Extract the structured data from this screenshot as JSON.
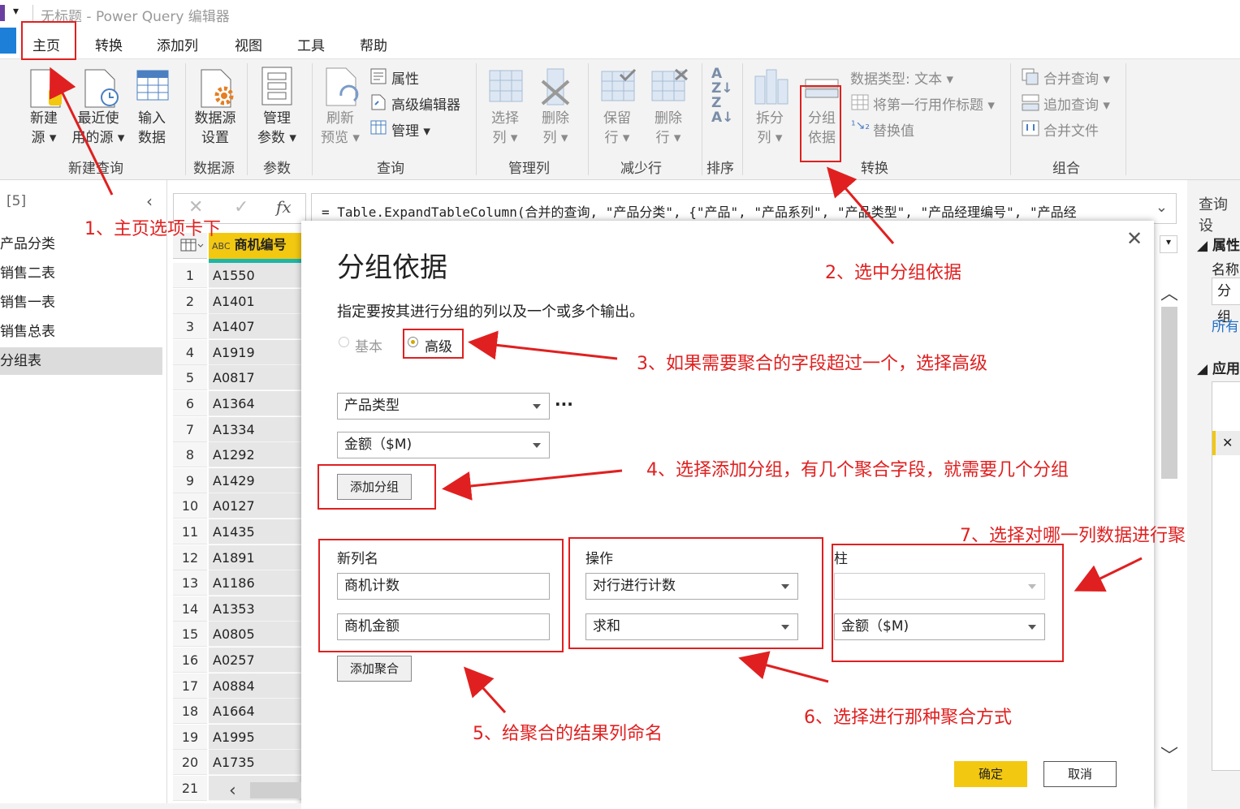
{
  "window": {
    "title": "无标题 - Power Query 编辑器"
  },
  "menu": {
    "items": [
      "主页",
      "转换",
      "添加列",
      "视图",
      "工具",
      "帮助"
    ]
  },
  "ribbon": {
    "new_query": {
      "new_source": "新建\n源 ▾",
      "recent_sources": "最近使\n用的源 ▾",
      "enter_data": "输入\n数据",
      "group": "新建查询"
    },
    "datasource": {
      "settings": "数据源\n设置",
      "group": "数据源"
    },
    "params": {
      "manage": "管理\n参数 ▾",
      "group": "参数"
    },
    "query": {
      "refresh": "刷新\n预览 ▾",
      "properties": "属性",
      "advanced_editor": "高级编辑器",
      "manage": "管理 ▾",
      "group": "查询"
    },
    "manage_cols": {
      "choose": "选择\n列 ▾",
      "remove": "删除\n列 ▾",
      "group": "管理列"
    },
    "reduce_rows": {
      "keep": "保留\n行 ▾",
      "remove": "删除\n行 ▾",
      "group": "减少行"
    },
    "sort": {
      "group": "排序"
    },
    "transform": {
      "split": "拆分\n列 ▾",
      "group_by": "分组\n依据",
      "data_type": "数据类型: 文本 ▾",
      "first_row_header": "将第一行用作标题 ▾",
      "replace": "替换值",
      "group": "转换"
    },
    "combine": {
      "merge": "合并查询 ▾",
      "append": "追加查询 ▾",
      "combine_files": "合并文件",
      "group": "组合"
    }
  },
  "left_panel": {
    "header": "[5]",
    "queries": [
      "产品分类",
      "销售二表",
      "销售一表",
      "销售总表",
      "分组表"
    ]
  },
  "formula": {
    "fx": "fx",
    "text": "= Table.ExpandTableColumn(合并的查询, \"产品分类\", {\"产品\", \"产品系列\", \"产品类型\", \"产品经理编号\", \"产品经"
  },
  "grid": {
    "col_type": "ABC",
    "col_header": "商机编号",
    "rows": [
      {
        "n": "1",
        "v": "A1550"
      },
      {
        "n": "2",
        "v": "A1401"
      },
      {
        "n": "3",
        "v": "A1407"
      },
      {
        "n": "4",
        "v": "A1919"
      },
      {
        "n": "5",
        "v": "A0817"
      },
      {
        "n": "6",
        "v": "A1364"
      },
      {
        "n": "7",
        "v": "A1334"
      },
      {
        "n": "8",
        "v": "A1292"
      },
      {
        "n": "9",
        "v": "A1429"
      },
      {
        "n": "10",
        "v": "A0127"
      },
      {
        "n": "11",
        "v": "A1435"
      },
      {
        "n": "12",
        "v": "A1891"
      },
      {
        "n": "13",
        "v": "A1186"
      },
      {
        "n": "14",
        "v": "A1353"
      },
      {
        "n": "15",
        "v": "A0805"
      },
      {
        "n": "16",
        "v": "A0257"
      },
      {
        "n": "17",
        "v": "A0884"
      },
      {
        "n": "18",
        "v": "A1664"
      },
      {
        "n": "19",
        "v": "A1995"
      },
      {
        "n": "20",
        "v": "A1735"
      },
      {
        "n": "21",
        "v": ""
      }
    ]
  },
  "right_panel": {
    "title": "查询设",
    "properties": "属性",
    "name_label": "名称",
    "name_value": "分组",
    "all_props": "所有",
    "applied": "应用"
  },
  "dialog": {
    "title": "分组依据",
    "description": "指定要按其进行分组的列以及一个或多个输出。",
    "radio_basic": "基本",
    "radio_advanced": "高级",
    "group_cols": [
      "产品类型",
      "金额（$M)"
    ],
    "more": "···",
    "add_group": "添加分组",
    "headers": {
      "name": "新列名",
      "operation": "操作",
      "column": "柱"
    },
    "aggs": [
      {
        "name": "商机计数",
        "op": "对行进行计数",
        "col": ""
      },
      {
        "name": "商机金额",
        "op": "求和",
        "col": "金额（$M)"
      }
    ],
    "add_agg": "添加聚合",
    "ok": "确定",
    "cancel": "取消"
  },
  "annotations": {
    "a1": "1、主页选项卡下",
    "a2": "2、选中分组依据",
    "a3": "3、如果需要聚合的字段超过一个，选择高级",
    "a4": "4、选择添加分组，有几个聚合字段，就需要几个分组",
    "a5": "5、给聚合的结果列命名",
    "a6": "6、选择进行那种聚合方式",
    "a7": "7、选择对哪一列数据进行聚"
  },
  "colors": {
    "accent": "#f2c811",
    "annotation": "#e02020",
    "active_tab_bar": "#1e90e0"
  }
}
